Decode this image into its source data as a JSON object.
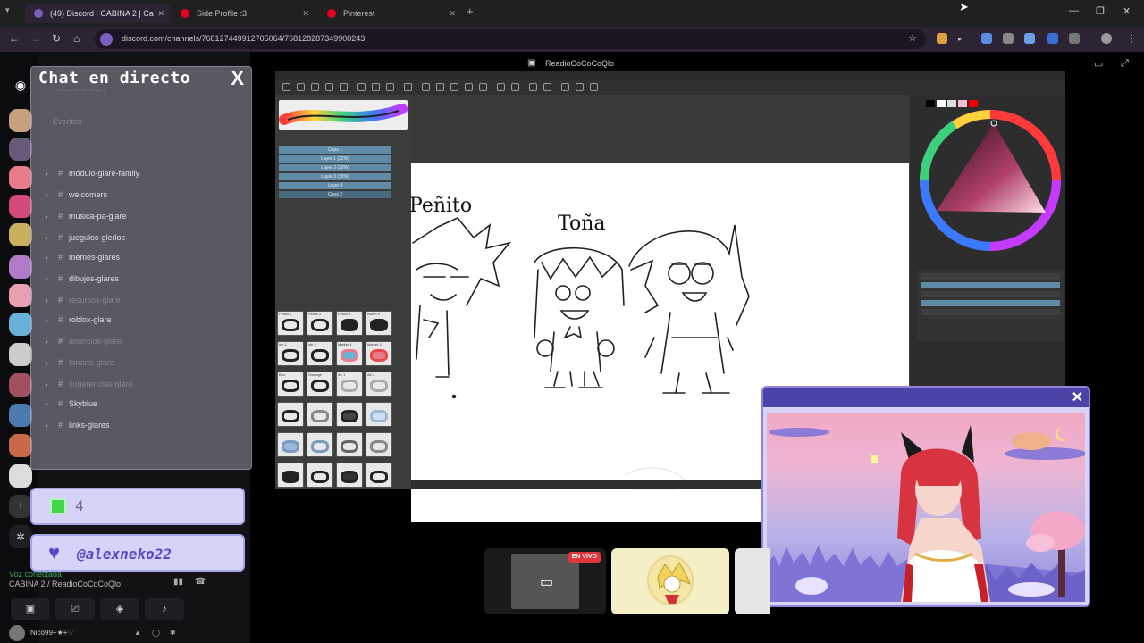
{
  "browser": {
    "tabs": [
      {
        "label": "(49) Discord | CABINA 2 | Ca",
        "active": true,
        "favicon_color": "#7a5fbf"
      },
      {
        "label": "Side Profile :3",
        "active": false,
        "favicon_color": "#e60023"
      },
      {
        "label": "Pinterest",
        "active": false,
        "favicon_color": "#e60023"
      }
    ],
    "url": "discord.com/channels/768127449912705064/768128287349900243"
  },
  "discord": {
    "stream_title": "ReadioCoCoCoQlo"
  },
  "chat": {
    "title": "Chat en directo",
    "close_label": "X",
    "subtitle": "· · · · · · · · · · · · · · · · · · ·",
    "search_placeholder": "Eventos",
    "channels": [
      {
        "label": "módulo-glare-family",
        "dim": false
      },
      {
        "label": "welcomers",
        "dim": false
      },
      {
        "label": "musica-pa-glare",
        "dim": false
      },
      {
        "label": "juegulos-glerlos",
        "dim": false
      },
      {
        "label": "memes-glares",
        "dim": false
      },
      {
        "label": "dibujos-glares",
        "dim": false
      },
      {
        "label": "recursos-glare",
        "dim": true
      },
      {
        "label": "roblox-glare",
        "dim": false
      },
      {
        "label": "anuncios-glare",
        "dim": true
      },
      {
        "label": "fanarts-glare",
        "dim": true
      },
      {
        "label": "sugerencias-glare",
        "dim": true
      },
      {
        "label": "Skyblue",
        "dim": false
      },
      {
        "label": "links-glares",
        "dim": false
      }
    ],
    "messages": [
      {
        "text": "4"
      },
      {
        "text": "@alexneko22"
      }
    ]
  },
  "paint": {
    "names": [
      "Peñito",
      "Toña"
    ],
    "layer_rows": [
      "Capa 1",
      "Layer 1 (22%)",
      "Layer 2 (22%)",
      "Layer 3 (30%)",
      "Layer 4",
      "Capa 2"
    ],
    "brushes": [
      "Pencil 1",
      "Pencil 2",
      "Pencil 3",
      "Brush 4",
      "Ink 1",
      "Ink 2",
      "Marker 1",
      "Marker 2",
      "Blur",
      "Smudge",
      "Air 1",
      "Air 2"
    ]
  },
  "tiles": {
    "live_badge": "EN VIVO"
  },
  "voice": {
    "status": "Voz conectada",
    "channel": "CABINA 2 / ReadioCoCoCoQlo",
    "username": "Nico99+★+♡"
  },
  "colors": {
    "chat_message_bg": "#d5d4f8",
    "mention_color": "#5a46c8",
    "live_badge": "#e2343b",
    "voice_green": "#3ba55c"
  }
}
